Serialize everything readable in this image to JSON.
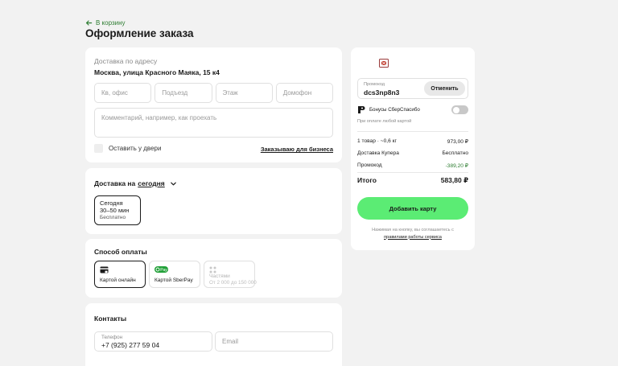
{
  "header": {
    "back_label": "В корзину",
    "title": "Оформление заказа"
  },
  "address": {
    "label": "Доставка по адресу",
    "value": "Москва, улица Красного Маяка, 15 к4",
    "fields": {
      "apartment": "Кв, офис",
      "entrance": "Подъезд",
      "floor": "Этаж",
      "intercom": "Домофон"
    },
    "comment_placeholder": "Комментарий, например, как проехать",
    "leave_at_door": "Оставить у двери",
    "business_link": "Заказываю для бизнеса"
  },
  "delivery": {
    "title_prefix": "Доставка на",
    "title_day": "сегодня",
    "slot": {
      "day": "Сегодня",
      "time": "30–50 мин",
      "price": "Бесплатно"
    }
  },
  "payment": {
    "title": "Способ оплаты",
    "options": [
      {
        "label": "Картой онлайн",
        "icon": "card-icon"
      },
      {
        "label": "Картой SberPay",
        "icon": "sberpay-icon",
        "badge": "Pay"
      },
      {
        "label": "Частями",
        "sub": "От 2 000 до 150 000",
        "icon": "installments-icon"
      }
    ]
  },
  "contacts": {
    "title": "Контакты",
    "phone_label": "Телефон",
    "phone_value": "+7 (925) 277 59 04",
    "email_placeholder": "Email"
  },
  "summary": {
    "promo_label": "Промокод",
    "promo_value": "dcs3np8n3",
    "cancel_label": "Отменить",
    "bonus_label": "Бонусы СберСпасибо",
    "bonus_note": "При оплате любой картой",
    "rows": {
      "items_label": "1 товар · ~0,6 кг",
      "items_value": "973,00 ₽",
      "delivery_label": "Доставка Купера",
      "delivery_value": "Бесплатно",
      "promo_label": "Промокод",
      "promo_value": "-389,20 ₽"
    },
    "total_label": "Итого",
    "total_value": "583,80 ₽",
    "pay_button": "Добавить карту",
    "terms_text": "Нажимая на кнопку, вы соглашаетесь с",
    "terms_link": "правилами работы сервиса"
  },
  "colors": {
    "accent_green": "#5bec74",
    "link_green": "#2e7d32",
    "background": "#f2f2f2"
  }
}
